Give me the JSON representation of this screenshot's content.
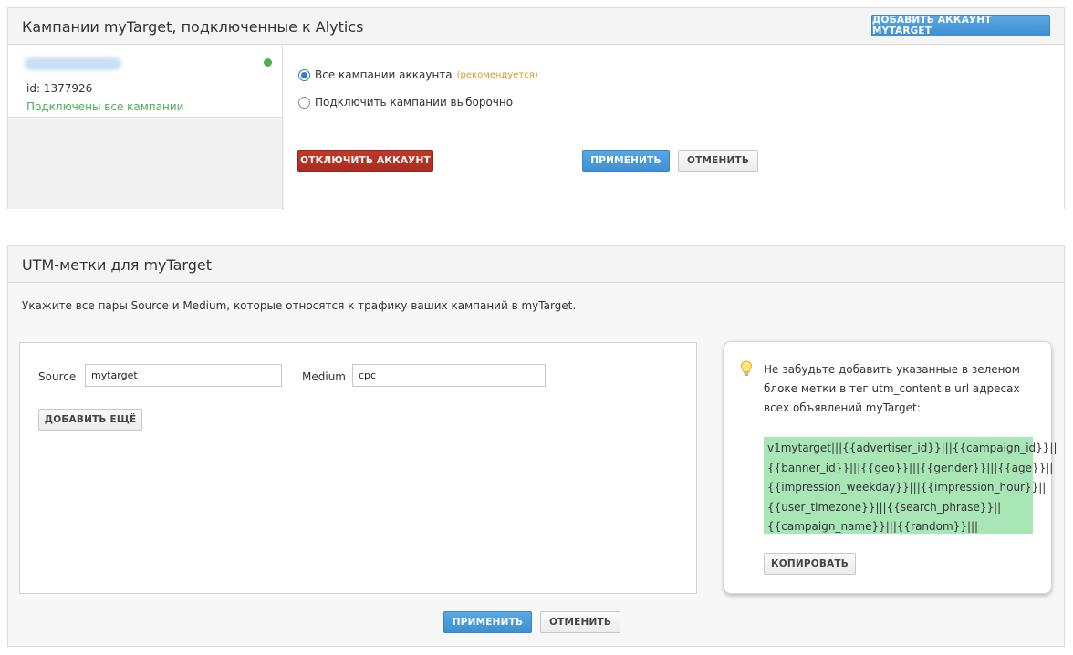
{
  "section1": {
    "title": "Кампании myTarget, подключенные к Alytics",
    "add_account_button": "ДОБАВИТЬ АККАУНТ MYTARGET",
    "account": {
      "id_text": "id: 1377926",
      "status_text": "Подключены все кампании",
      "status_color": "#4caf50"
    },
    "radio_all_label": "Все кампании аккаунта",
    "radio_all_hint": "(рекомендуется)",
    "radio_selective_label": "Подключить кампании выборочно",
    "selected_option": "all",
    "disconnect_button": "ОТКЛЮЧИТЬ АККАУНТ",
    "apply_button": "ПРИМЕНИТЬ",
    "cancel_button": "ОТМЕНИТЬ"
  },
  "section2": {
    "title": "UTM-метки для myTarget",
    "description": "Укажите все пары Source и Medium, которые относятся к трафику ваших кампаний в myTarget.",
    "source_label": "Source",
    "source_value": "mytarget",
    "medium_label": "Medium",
    "medium_value": "cpc",
    "add_more_button": "ДОБАВИТЬ ЕЩЁ",
    "tip_text": "Не забудьте добавить указанные в зеленом блоке метки в тег utm_content в url адресах всех объявлений myTarget:",
    "utm_lines": [
      "v1mytarget|||{{advertiser_id}}|||{{campaign_id}}||",
      "{{banner_id}}|||{{geo}}|||{{gender}}|||{{age}}||",
      "{{impression_weekday}}|||{{impression_hour}}||",
      "{{user_timezone}}|||{{search_phrase}}||",
      "{{campaign_name}}|||{{random}}|||"
    ],
    "copy_button": "КОПИРОВАТЬ",
    "apply_button": "ПРИМЕНИТЬ",
    "cancel_button": "ОТМЕНИТЬ"
  },
  "colors": {
    "primary_blue": "#4a9ad9",
    "danger_red": "#b8342a",
    "utm_highlight_green": "#a8e6b6",
    "hint_orange": "#d89a23"
  }
}
